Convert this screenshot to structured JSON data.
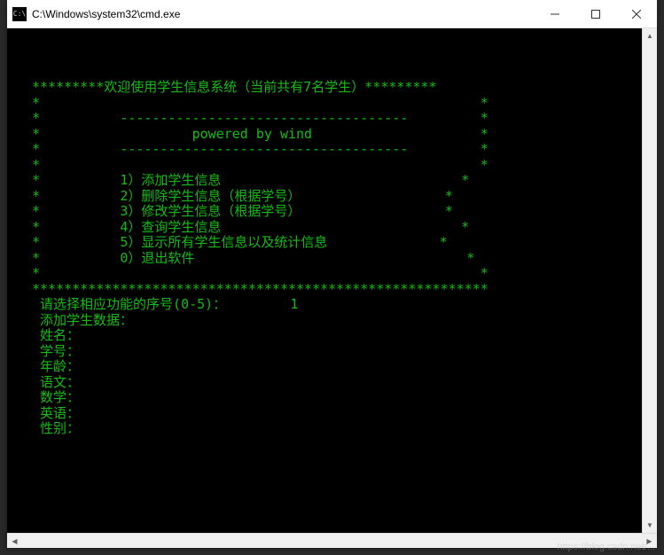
{
  "titlebar": {
    "icon_label": "C:\\",
    "title": "C:\\Windows\\system32\\cmd.exe"
  },
  "console": {
    "banner_top": "*********欢迎使用学生信息系统（当前共有7名学生）*********",
    "border_empty": "*                                                       *",
    "divider": "*          ------------------------------------         *",
    "powered": "*                   powered by wind                     *",
    "menu": [
      "*          1）添加学生信息                              *",
      "*          2）删除学生信息（根据学号）                  *",
      "*          3）修改学生信息（根据学号）                  *",
      "*          4）查询学生信息                              *",
      "*          5）显示所有学生信息以及统计信息              *",
      "*          0）退出软件                                  *"
    ],
    "banner_bottom": "*********************************************************",
    "prompt_select": " 请选择相应功能的序号(0-5)：        1",
    "add_header": " 添加学生数据：",
    "fields": [
      " 姓名：",
      " 学号：",
      " 年龄：",
      " 语文：",
      " 数学：",
      " 英语：",
      " 性别："
    ]
  },
  "watermark": "https://blog.csdn.net/..."
}
